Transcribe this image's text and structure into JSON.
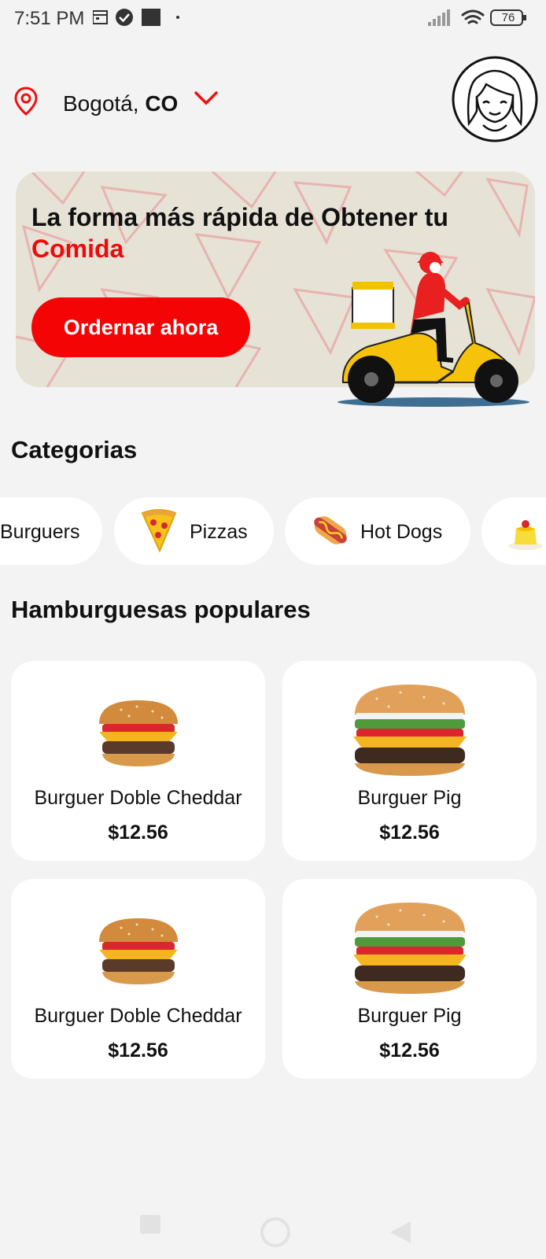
{
  "status_bar": {
    "time": "7:51 PM",
    "battery": "76"
  },
  "location": {
    "city": "Bogotá,",
    "country": "CO"
  },
  "banner": {
    "title_line1": "La forma más rápida de Obtener tu",
    "title_highlight": "Comida",
    "cta_label": "Ordernar ahora"
  },
  "categories": {
    "heading": "Categorias",
    "items": [
      {
        "label": "Burguers",
        "icon": "burger-icon"
      },
      {
        "label": "Pizzas",
        "icon": "pizza-icon"
      },
      {
        "label": "Hot Dogs",
        "icon": "hotdog-icon"
      },
      {
        "label": "",
        "icon": "dessert-icon"
      }
    ]
  },
  "popular": {
    "heading": "Hamburguesas populares",
    "items": [
      {
        "name": "Burguer Doble Cheddar",
        "price": "$12.56",
        "image": "small-burger"
      },
      {
        "name": "Burguer Pig",
        "price": "$12.56",
        "image": "big-burger"
      },
      {
        "name": "Burguer Doble Cheddar",
        "price": "$12.56",
        "image": "small-burger"
      },
      {
        "name": "Burguer Pig",
        "price": "$12.56",
        "image": "big-burger"
      }
    ]
  },
  "colors": {
    "accent": "#f40404",
    "banner_bg": "#e6e2d6",
    "page_bg": "#f3f3f3"
  }
}
